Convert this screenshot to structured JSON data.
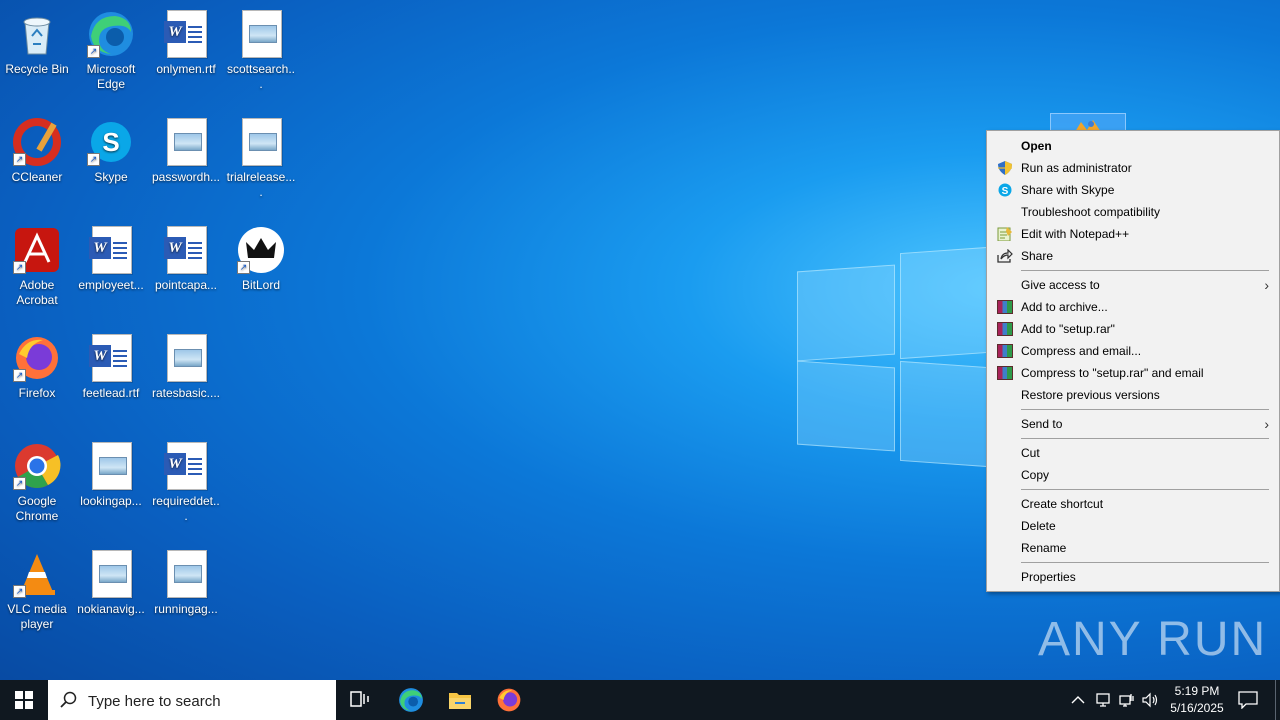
{
  "desktop": {
    "icons": [
      {
        "label": "Recycle Bin",
        "icon": "recycle-bin-icon"
      },
      {
        "label": "Microsoft Edge",
        "icon": "edge-icon"
      },
      {
        "label": "onlymen.rtf",
        "icon": "word-document-icon"
      },
      {
        "label": "scottsearch...",
        "icon": "image-file-icon"
      },
      {
        "label": "CCleaner",
        "icon": "ccleaner-icon"
      },
      {
        "label": "Skype",
        "icon": "skype-icon"
      },
      {
        "label": "passwordh...",
        "icon": "image-file-icon"
      },
      {
        "label": "trialrelease....",
        "icon": "image-file-icon"
      },
      {
        "label": "Adobe Acrobat",
        "icon": "acrobat-icon"
      },
      {
        "label": "employeet...",
        "icon": "word-document-icon"
      },
      {
        "label": "pointcapa...",
        "icon": "word-document-icon"
      },
      {
        "label": "BitLord",
        "icon": "bitlord-icon"
      },
      {
        "label": "Firefox",
        "icon": "firefox-icon"
      },
      {
        "label": "feetlead.rtf",
        "icon": "word-document-icon"
      },
      {
        "label": "ratesbasic....",
        "icon": "image-file-icon"
      },
      {
        "label": "Google Chrome",
        "icon": "chrome-icon"
      },
      {
        "label": "lookingap...",
        "icon": "image-file-icon"
      },
      {
        "label": "requireddet...",
        "icon": "word-document-icon"
      },
      {
        "label": "VLC media player",
        "icon": "vlc-icon"
      },
      {
        "label": "nokianavig...",
        "icon": "image-file-icon"
      },
      {
        "label": "runningag...",
        "icon": "image-file-icon"
      }
    ]
  },
  "context_menu": {
    "open": "Open",
    "run_as_admin": "Run as administrator",
    "share_skype": "Share with Skype",
    "troubleshoot": "Troubleshoot compatibility",
    "edit_notepad": "Edit with Notepad++",
    "share": "Share",
    "give_access": "Give access to",
    "add_archive": "Add to archive...",
    "add_setup_rar": "Add to \"setup.rar\"",
    "compress_email": "Compress and email...",
    "compress_setup_email": "Compress to \"setup.rar\" and email",
    "restore_versions": "Restore previous versions",
    "send_to": "Send to",
    "cut": "Cut",
    "copy": "Copy",
    "create_shortcut": "Create shortcut",
    "delete": "Delete",
    "rename": "Rename",
    "properties": "Properties"
  },
  "watermark": "ANY RUN",
  "taskbar": {
    "search_placeholder": "Type here to search",
    "time": "5:19 PM",
    "date": "5/16/2025"
  },
  "colors": {
    "menu_bg": "#f2f2f2",
    "taskbar_bg": "#101820",
    "desktop_accent": "#0c78d8"
  }
}
